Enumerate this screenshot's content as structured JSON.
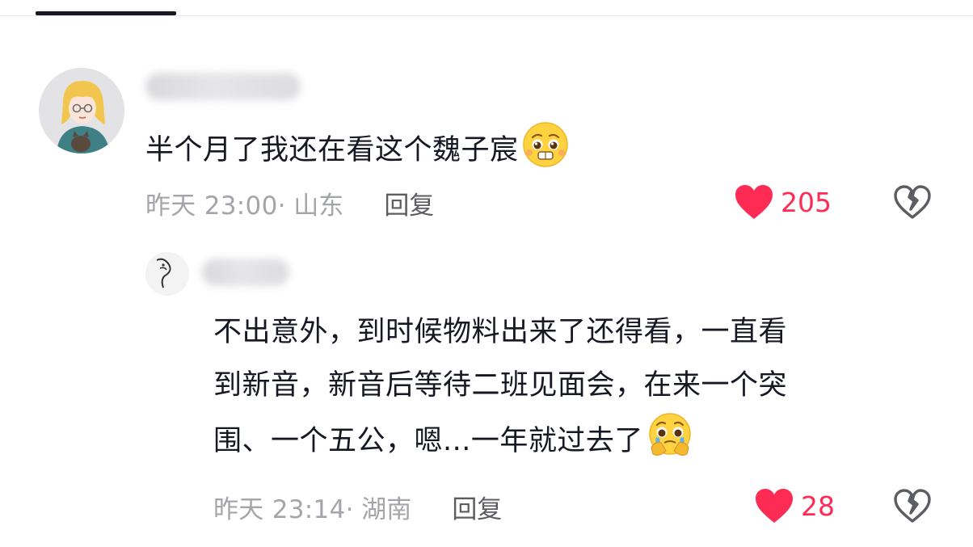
{
  "comments": [
    {
      "text": "半个月了我还在看这个魏子宸",
      "emoji": "pleading-face",
      "time": "昨天 23:00",
      "location": "· 山东",
      "reply_label": "回复",
      "likes": "205"
    },
    {
      "text_lines": [
        "不出意外，到时候物料出来了还得看，一直看",
        "到新音，新音后等待二班见面会，在来一个突",
        "围、一个五公，嗯...一年就过去了"
      ],
      "emoji": "face-holding-back-tears",
      "time": "昨天 23:14",
      "location": "· 湖南",
      "reply_label": "回复",
      "likes": "28"
    }
  ],
  "colors": {
    "like_red": "#fe2c55",
    "meta_gray": "#a4a5aa",
    "text": "#161823",
    "reply_gray": "#5c5d63"
  },
  "icons": [
    "heart-icon",
    "broken-heart-icon",
    "pleading-face-emoji",
    "face-holding-back-tears-emoji"
  ]
}
